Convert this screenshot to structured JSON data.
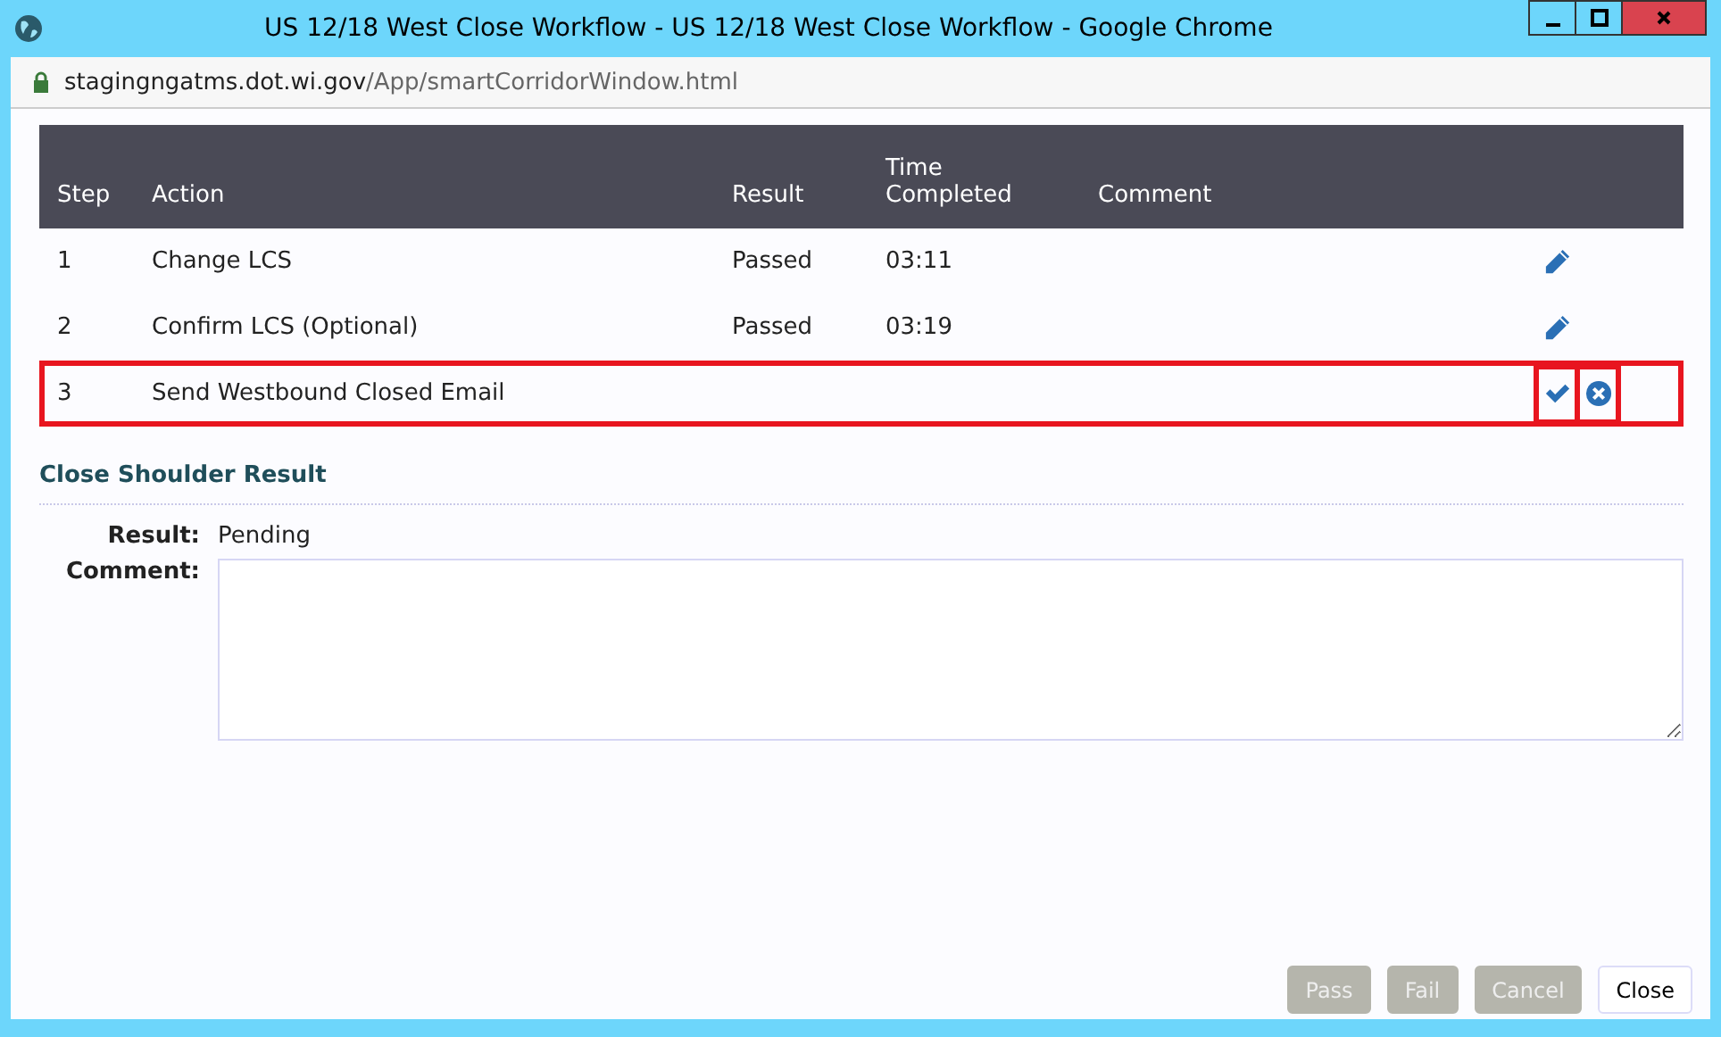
{
  "window": {
    "title": "US 12/18 West Close Workflow - US 12/18 West Close Workflow - Google Chrome"
  },
  "address_bar": {
    "host": "stagingngatms.dot.wi.gov",
    "path": "/App/smartCorridorWindow.html"
  },
  "table": {
    "columns": [
      "Step",
      "Action",
      "Result",
      "Time Completed",
      "Comment"
    ],
    "rows": [
      {
        "step": "1",
        "action": "Change LCS",
        "result": "Passed",
        "time": "03:11",
        "kind": "done",
        "highlighted": false
      },
      {
        "step": "2",
        "action": "Confirm LCS (Optional)",
        "result": "Passed",
        "time": "03:19",
        "kind": "done",
        "highlighted": false
      },
      {
        "step": "3",
        "action": "Send Westbound Closed Email",
        "kind": "pending",
        "highlighted": true
      }
    ]
  },
  "detail": {
    "title": "Close Shoulder Result",
    "result_label": "Result:",
    "result_value": "Pending",
    "comment_label": "Comment:"
  },
  "buttons": [
    {
      "label": "Pass",
      "disabled": true
    },
    {
      "label": "Fail",
      "disabled": true
    },
    {
      "label": "Cancel",
      "disabled": true
    },
    {
      "label": "Close",
      "disabled": false
    }
  ]
}
